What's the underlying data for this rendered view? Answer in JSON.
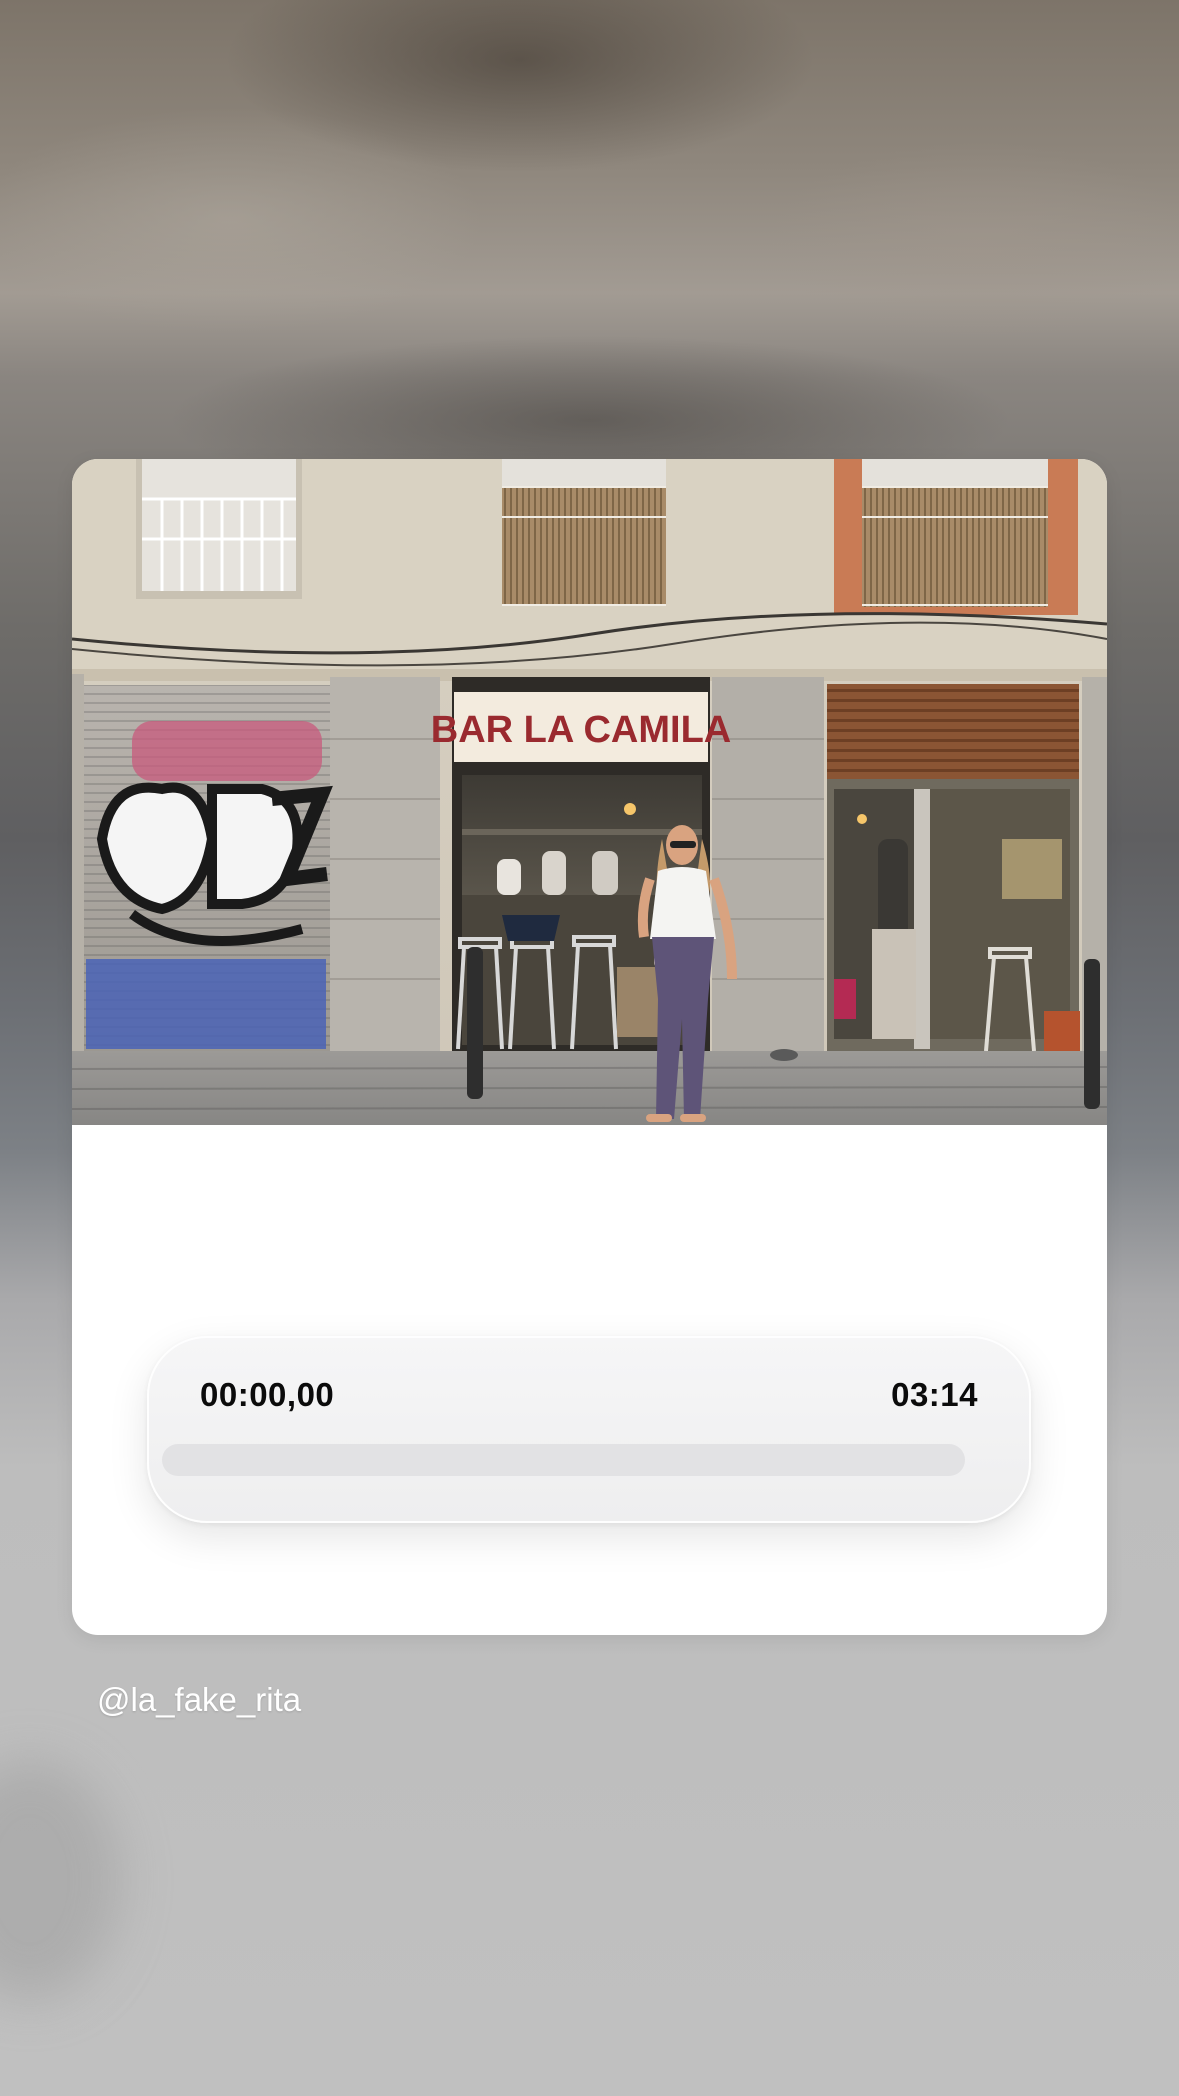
{
  "card": {
    "photo": {
      "sign_text": "BAR LA CAMILA"
    },
    "player": {
      "elapsed": "00:00,00",
      "total": "03:14",
      "progress": 0
    }
  },
  "username": "@la_fake_rita",
  "colors": {
    "card_background": "#ffffff",
    "player_background": "#f2f2f3",
    "progress_track": "#e2e2e4",
    "sign_background": "#f3ebde",
    "sign_text": "#9a2a2f",
    "username_text": "#ffffff"
  }
}
